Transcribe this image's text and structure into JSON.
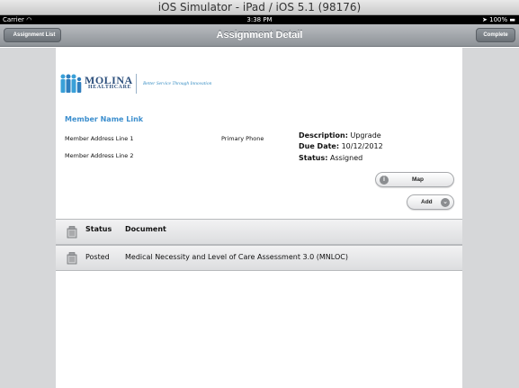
{
  "simulator": {
    "title": "iOS Simulator - iPad / iOS 5.1 (98176)"
  },
  "status_bar": {
    "carrier": "Carrier",
    "time": "3:38 PM",
    "battery": "100%"
  },
  "nav_bar": {
    "back_label": "Assignment List",
    "title": "Assignment Detail",
    "right_label": "Complete"
  },
  "logo": {
    "name_line1": "MOLINA",
    "name_line2": "HEALTHCARE",
    "tagline": "Better Service Through Innovation",
    "brand_color": "#2c4f7c",
    "accent_color": "#3d8fce"
  },
  "member": {
    "name_link": "Member Name Link",
    "address_line1": "Member Address Line 1",
    "address_line2": "Member Address Line 2",
    "phone_label": "Primary Phone"
  },
  "assignment": {
    "description_label": "Description:",
    "description_value": "Upgrade",
    "due_label": "Due Date:",
    "due_value": "10/12/2012",
    "status_label": "Status:",
    "status_value": "Assigned"
  },
  "buttons": {
    "map_label": "Map",
    "map_icon": "info-icon",
    "add_label": "Add",
    "add_icon": "chevron-down-icon"
  },
  "table": {
    "columns": [
      "Status",
      "Document"
    ],
    "rows": [
      {
        "status": "Posted",
        "document": "Medical Necessity and Level of Care Assessment 3.0 (MNLOC)"
      }
    ]
  }
}
